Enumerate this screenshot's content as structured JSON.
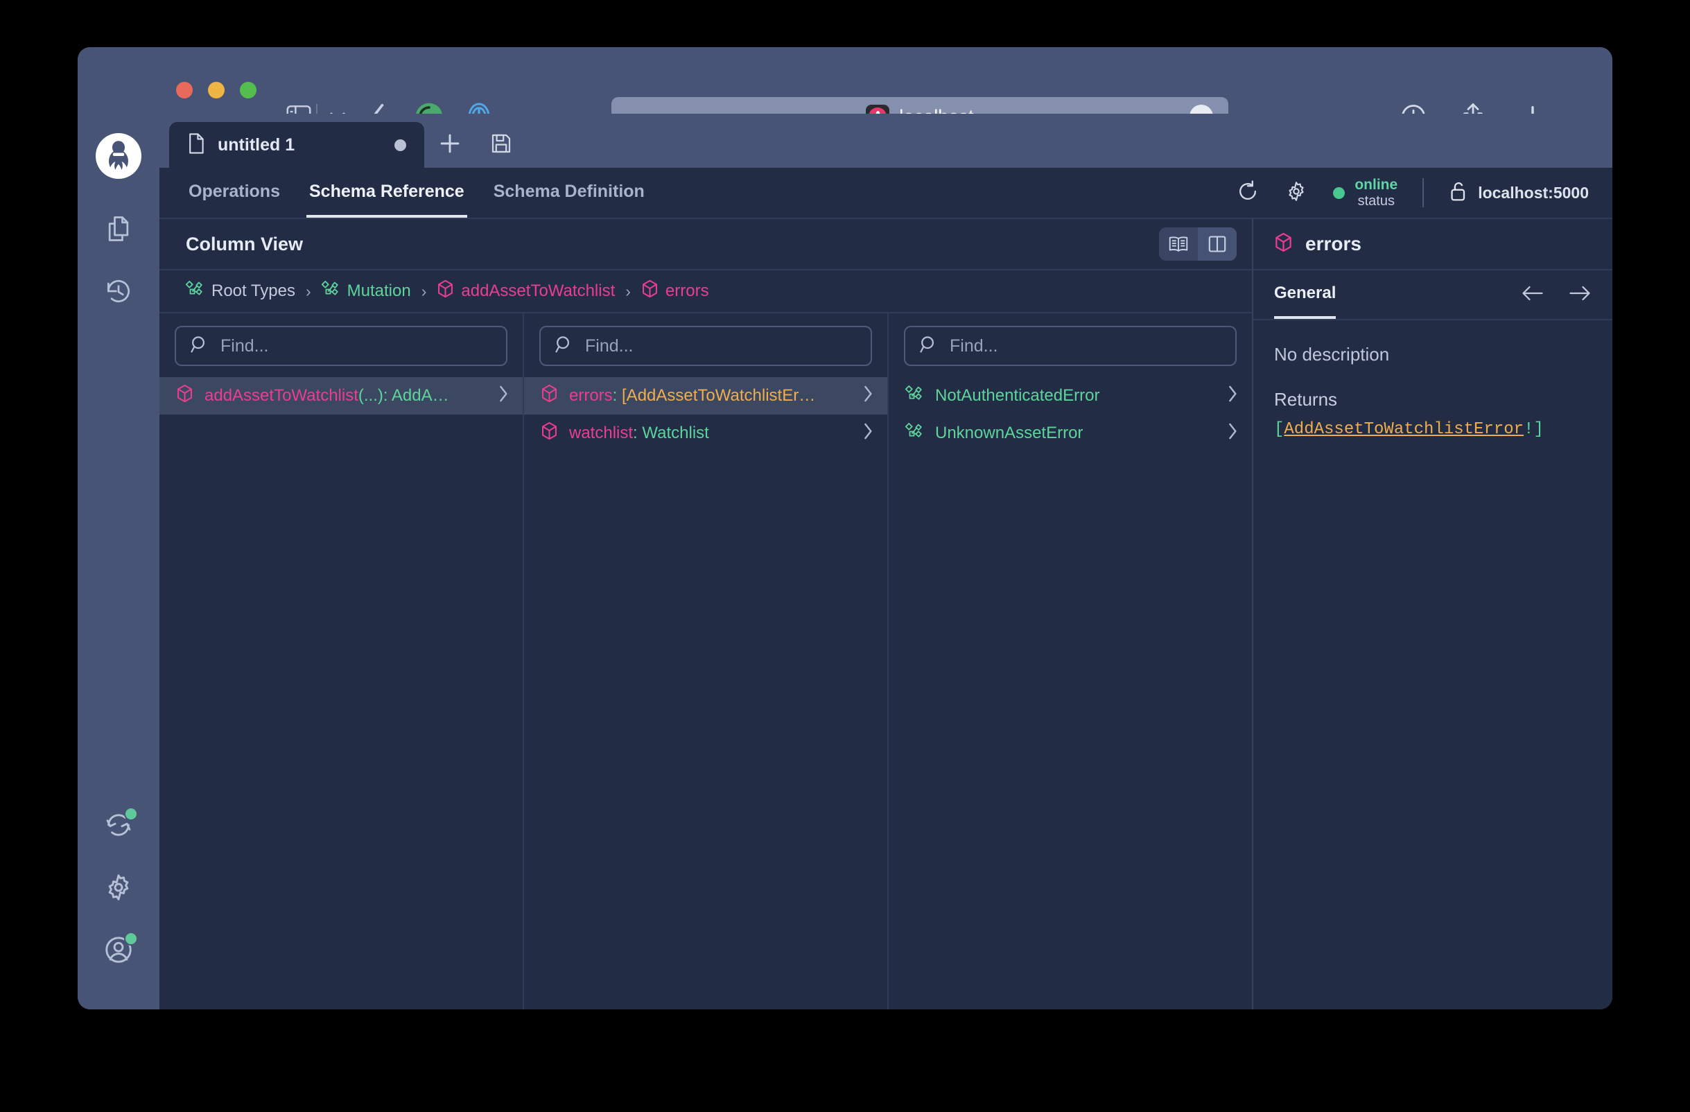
{
  "browser": {
    "url_text": "localhost",
    "favicon_name": "postman-icon",
    "traffic_lights": [
      "close",
      "minimize",
      "zoom"
    ],
    "toolbar_icons": [
      "sidebar-toggle-icon",
      "chevron-down-icon",
      "back-icon",
      "grammarly-icon",
      "onepassword-icon"
    ],
    "right_icons": [
      "downloads-icon",
      "share-icon",
      "new-tab-icon"
    ],
    "more_label": "..."
  },
  "rail": {
    "logo_name": "altair-graphql-logo",
    "items": [
      {
        "name": "documents-icon",
        "badge": false
      },
      {
        "name": "history-icon",
        "badge": false
      },
      {
        "name": "sync-icon",
        "badge": true
      },
      {
        "name": "gear-icon",
        "badge": false
      },
      {
        "name": "account-icon",
        "badge": true
      }
    ]
  },
  "doc_tab": {
    "label": "untitled 1",
    "file_icon": "file-icon",
    "dirty": true,
    "add_label": "+",
    "save_icon": "save-icon"
  },
  "nav": {
    "tabs": [
      {
        "label": "Operations",
        "active": false
      },
      {
        "label": "Schema Reference",
        "active": true
      },
      {
        "label": "Schema Definition",
        "active": false
      }
    ],
    "reload_icon": "reload-icon",
    "settings_icon": "gear-icon",
    "status_value": "online",
    "status_label": "status",
    "status_color": "#48c78e",
    "lock_icon": "unlocked-icon",
    "host": "localhost:5000"
  },
  "column_view": {
    "title": "Column View",
    "view_modes": [
      {
        "name": "book-view-icon",
        "active": false
      },
      {
        "name": "column-view-icon",
        "active": true
      }
    ],
    "breadcrumb": [
      {
        "label": "Root Types",
        "icon": "interface-icon",
        "color": "grey"
      },
      {
        "label": "Mutation",
        "icon": "interface-icon",
        "color": "green"
      },
      {
        "label": "addAssetToWatchlist",
        "icon": "type-icon",
        "color": "pink"
      },
      {
        "label": "errors",
        "icon": "type-icon",
        "color": "pink"
      }
    ],
    "breadcrumb_separator": "›",
    "columns": [
      {
        "search_placeholder": "Find...",
        "search_value": "",
        "rows": [
          {
            "icon": "type-icon",
            "selected": true,
            "has_chevron": true,
            "parts": [
              {
                "text": "addAssetToWatchlist",
                "color": "pink"
              },
              {
                "text": "(...): ",
                "color": "green"
              },
              {
                "text": "AddA…",
                "color": "green"
              }
            ]
          }
        ]
      },
      {
        "search_placeholder": "Find...",
        "search_value": "",
        "rows": [
          {
            "icon": "type-icon",
            "selected": true,
            "has_chevron": true,
            "parts": [
              {
                "text": "errors",
                "color": "pink"
              },
              {
                "text": ": ",
                "color": "green"
              },
              {
                "text": "[AddAssetToWatchlistEr…",
                "color": "orange"
              }
            ]
          },
          {
            "icon": "type-icon",
            "selected": false,
            "has_chevron": true,
            "parts": [
              {
                "text": "watchlist",
                "color": "pink"
              },
              {
                "text": ": ",
                "color": "green"
              },
              {
                "text": "Watchlist",
                "color": "green"
              }
            ]
          }
        ]
      },
      {
        "search_placeholder": "Find...",
        "search_value": "",
        "rows": [
          {
            "icon": "interface-icon",
            "selected": false,
            "has_chevron": true,
            "parts": [
              {
                "text": "NotAuthenticatedError",
                "color": "green"
              }
            ]
          },
          {
            "icon": "interface-icon",
            "selected": false,
            "has_chevron": true,
            "parts": [
              {
                "text": "UnknownAssetError",
                "color": "green"
              }
            ]
          }
        ]
      }
    ]
  },
  "detail": {
    "icon": "type-icon",
    "title": "errors",
    "tab_label": "General",
    "prev_icon": "arrow-left-icon",
    "next_icon": "arrow-right-icon",
    "description": "No description",
    "returns_label": "Returns",
    "returns_code": {
      "open": "[",
      "type": "AddAssetToWatchlistError",
      "bang": "!",
      "close": "]"
    }
  }
}
